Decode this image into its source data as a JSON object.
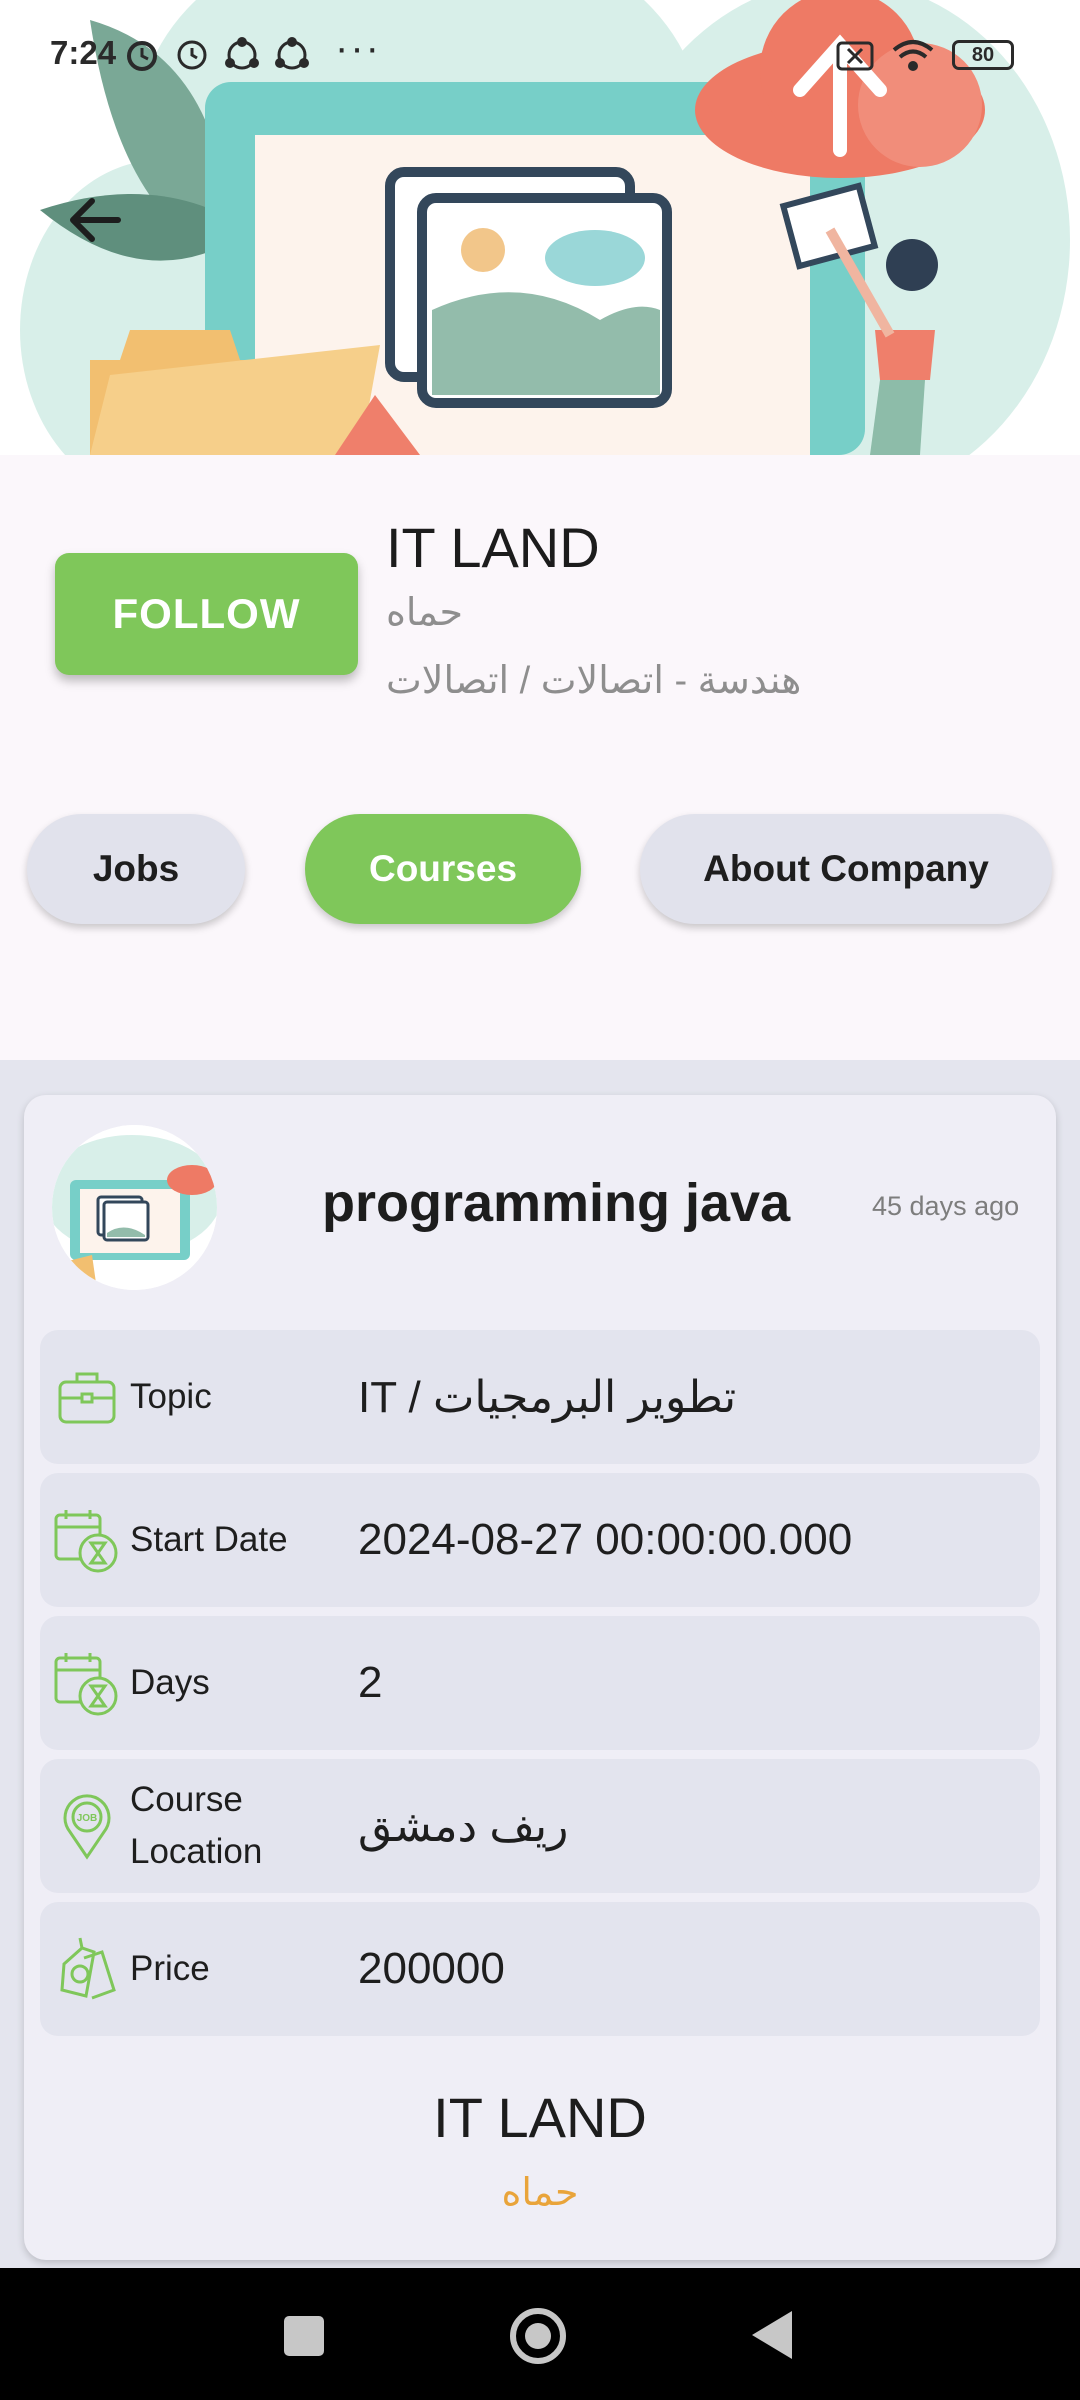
{
  "status_bar": {
    "time": "7:24",
    "more": "···",
    "battery": "80"
  },
  "company": {
    "follow_label": "FOLLOW",
    "name": "IT LAND",
    "city": "حماه",
    "category": "هندسة - اتصالات / اتصالات"
  },
  "tabs": [
    {
      "label": "Jobs",
      "active": false
    },
    {
      "label": "Courses",
      "active": true
    },
    {
      "label": "About Company",
      "active": false
    }
  ],
  "course": {
    "title": "programming java",
    "posted": "45 days ago",
    "rows": [
      {
        "label": "Topic",
        "value": "IT / تطوير البرمجيات",
        "icon": "briefcase-icon"
      },
      {
        "label": "Start Date",
        "value": "2024-08-27 00:00:00.000",
        "icon": "calendar-hourglass-icon"
      },
      {
        "label": "Days",
        "value": "2",
        "icon": "calendar-hourglass-icon"
      },
      {
        "label": "Course Location",
        "value": "ريف دمشق",
        "icon": "job-location-pin-icon"
      },
      {
        "label": "Price",
        "value": "200000",
        "icon": "price-tag-icon"
      }
    ],
    "footer_name": "IT LAND",
    "footer_city": "حماه"
  },
  "colors": {
    "accent": "#7fc75a",
    "city_footer": "#e9a43a",
    "card_bg": "#efeef6",
    "row_bg": "#e3e4ee"
  }
}
